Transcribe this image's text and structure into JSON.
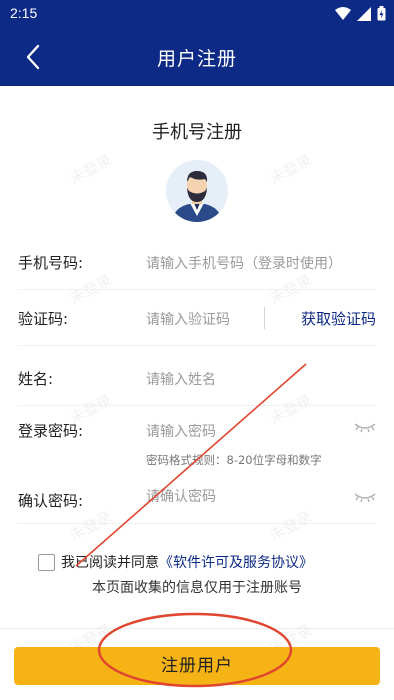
{
  "status": {
    "time": "2:15",
    "icons": [
      "wifi-icon",
      "signal-icon",
      "battery-icon"
    ]
  },
  "nav": {
    "title": "用户注册",
    "back_icon": "chevron-left-icon"
  },
  "page": {
    "subtitle": "手机号注册"
  },
  "form": {
    "phone": {
      "label": "手机号码:",
      "placeholder": "请输入手机号码（登录时使用）"
    },
    "code": {
      "label": "验证码:",
      "placeholder": "请输入验证码",
      "get_code": "获取验证码"
    },
    "name": {
      "label": "姓名:",
      "placeholder": "请输入姓名"
    },
    "password": {
      "label": "登录密码:",
      "placeholder": "请输入密码",
      "hint": "密码格式规则：8-20位字母和数字"
    },
    "confirm": {
      "label": "确认密码:",
      "placeholder": "请确认密码"
    }
  },
  "agreement": {
    "prefix": "我已阅读并同意",
    "link": "《软件许可及服务协议》",
    "notice": "本页面收集的信息仅用于注册账号"
  },
  "submit_label": "注册用户",
  "watermark": "未登录",
  "colors": {
    "primary": "#0d2a86",
    "accent": "#f6b315",
    "annotation": "#e0452f"
  }
}
